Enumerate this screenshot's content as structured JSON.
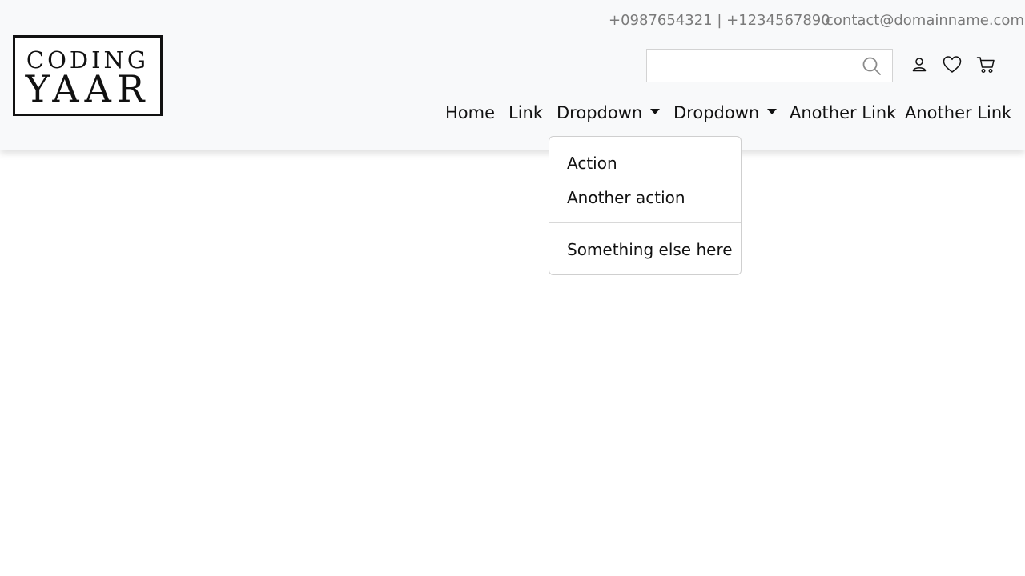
{
  "brand": {
    "line1": "CODING",
    "line2": "YAAR"
  },
  "contact": {
    "phones": "+0987654321 | +1234567890",
    "email": "contact@domainname.com"
  },
  "search": {
    "placeholder": "",
    "value": ""
  },
  "icons": {
    "search": "search-icon",
    "user": "user-icon",
    "wishlist": "heart-icon",
    "cart": "cart-icon"
  },
  "nav": {
    "items": [
      {
        "label": "Home"
      },
      {
        "label": "Link"
      },
      {
        "label": "Dropdown",
        "has_dropdown": true
      },
      {
        "label": "Dropdown",
        "has_dropdown": true
      },
      {
        "label": "Another Link"
      },
      {
        "label": "Another Link"
      }
    ]
  },
  "dropdown": {
    "items": [
      {
        "label": "Action"
      },
      {
        "label": "Another action"
      },
      {
        "label": "Something else here"
      }
    ]
  },
  "colors": {
    "header_bg": "#f8f9fa",
    "text": "#111111",
    "muted_text": "#7a7a7a"
  }
}
